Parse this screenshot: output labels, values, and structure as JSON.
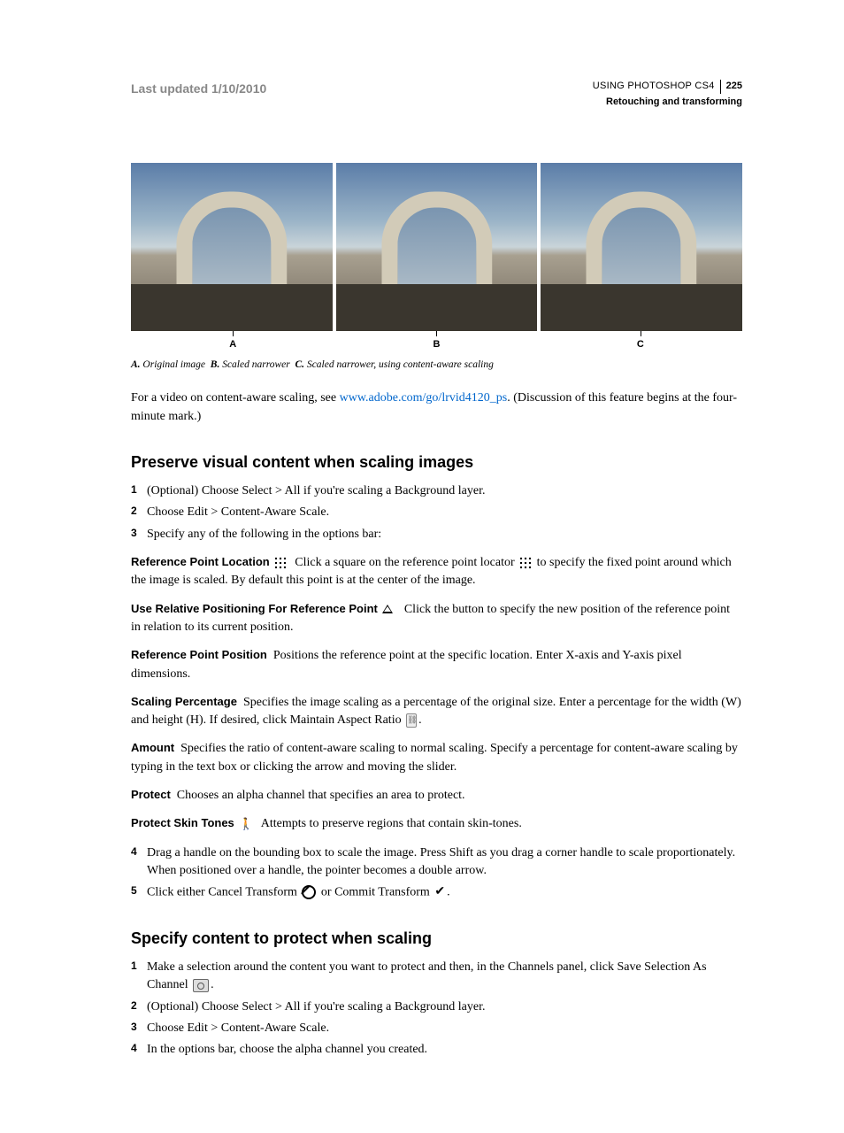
{
  "header": {
    "last_updated": "Last updated 1/10/2010",
    "doc_title": "USING PHOTOSHOP CS4",
    "page_number": "225",
    "chapter": "Retouching and transforming"
  },
  "figure": {
    "labels": [
      "A",
      "B",
      "C"
    ],
    "caption_parts": {
      "a_label": "A.",
      "a_text": "Original image",
      "b_label": "B.",
      "b_text": "Scaled narrower",
      "c_label": "C.",
      "c_text": "Scaled narrower, using content-aware scaling"
    }
  },
  "intro": {
    "before_link": "For a video on content-aware scaling, see ",
    "link_text": "www.adobe.com/go/lrvid4120_ps",
    "after_link": ". (Discussion of this feature begins at the four-minute mark.)"
  },
  "section1": {
    "heading": "Preserve visual content when scaling images",
    "steps_top": [
      "(Optional) Choose Select > All if you're scaling a Background layer.",
      "Choose Edit > Content-Aware Scale.",
      "Specify any of the following in the options bar:"
    ],
    "defs": {
      "ref_point_loc": {
        "term": "Reference Point Location",
        "text_before": "Click a square on the reference point locator",
        "text_after": "to specify the fixed point around which the image is scaled. By default this point is at the center of the image."
      },
      "rel_pos": {
        "term": "Use Relative Positioning For Reference Point",
        "text": "Click the button to specify the new position of the reference point in relation to its current position."
      },
      "ref_point_pos": {
        "term": "Reference Point Position",
        "text": "Positions the reference point at the specific location. Enter X-axis and Y-axis pixel dimensions."
      },
      "scaling_pct": {
        "term": "Scaling Percentage",
        "text": "Specifies the image scaling as a percentage of the original size. Enter a percentage for the width (W) and height (H). If desired, click Maintain Aspect Ratio",
        "after": "."
      },
      "amount": {
        "term": "Amount",
        "text": "Specifies the ratio of content-aware scaling to normal scaling. Specify a percentage for content-aware scaling by typing in the text box or clicking the arrow and moving the slider."
      },
      "protect": {
        "term": "Protect",
        "text": "Chooses an alpha channel that specifies an area to protect."
      },
      "skin": {
        "term": "Protect Skin Tones",
        "text": "Attempts to preserve regions that contain skin-tones."
      }
    },
    "step4": "Drag a handle on the bounding box to scale the image. Press Shift as you drag a corner handle to scale proportionately. When positioned over a handle, the pointer becomes a double arrow.",
    "step5_before": "Click either Cancel Transform",
    "step5_mid": "or Commit Transform",
    "step5_after": "."
  },
  "section2": {
    "heading": "Specify content to protect when scaling",
    "step1_before": "Make a selection around the content you want to protect and then, in the Channels panel, click Save Selection As Channel",
    "step1_after": ".",
    "steps": [
      "(Optional) Choose Select > All if you're scaling a Background layer.",
      "Choose Edit > Content-Aware Scale.",
      "In the options bar, choose the alpha channel you created."
    ]
  }
}
